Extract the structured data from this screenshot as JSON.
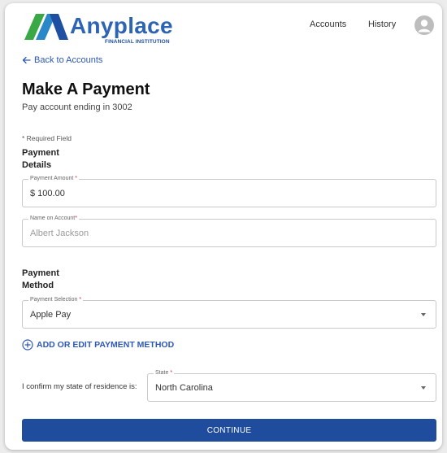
{
  "brand": {
    "name": "Anyplace",
    "tagline": "FINANCIAL INSTITUTION",
    "colors": {
      "primary": "#2d64b3",
      "logo_green": "#3aa847",
      "logo_blue": "#1f4fa0",
      "button": "#1f4c9c",
      "link": "#2d58b8"
    }
  },
  "nav": {
    "items": [
      {
        "label": "Accounts"
      },
      {
        "label": "History"
      }
    ],
    "avatar_icon": "user-avatar-icon"
  },
  "back_link": {
    "label": "Back to Accounts",
    "icon": "arrow-left-icon"
  },
  "page": {
    "title": "Make A Payment",
    "subtitle": "Pay account ending in 3002",
    "required_note": "* Required Field"
  },
  "payment_details": {
    "title": "Payment Details",
    "amount": {
      "label": "Payment Amount",
      "required_mark": "*",
      "value": "$ 100.00"
    },
    "name": {
      "label": "Name on Account",
      "required_mark": "*",
      "value": "Albert Jackson"
    }
  },
  "payment_method": {
    "title": "Payment Method",
    "selection": {
      "label": "Payment Selection",
      "required_mark": "*",
      "value": "Apple Pay"
    },
    "add_link": {
      "label": "ADD OR EDIT PAYMENT METHOD",
      "icon": "plus-circle-icon"
    }
  },
  "residence": {
    "confirm_text": "I confirm my state of residence is:",
    "state": {
      "label": "State",
      "required_mark": "*",
      "value": "North Carolina"
    }
  },
  "continue_label": "CONTINUE"
}
